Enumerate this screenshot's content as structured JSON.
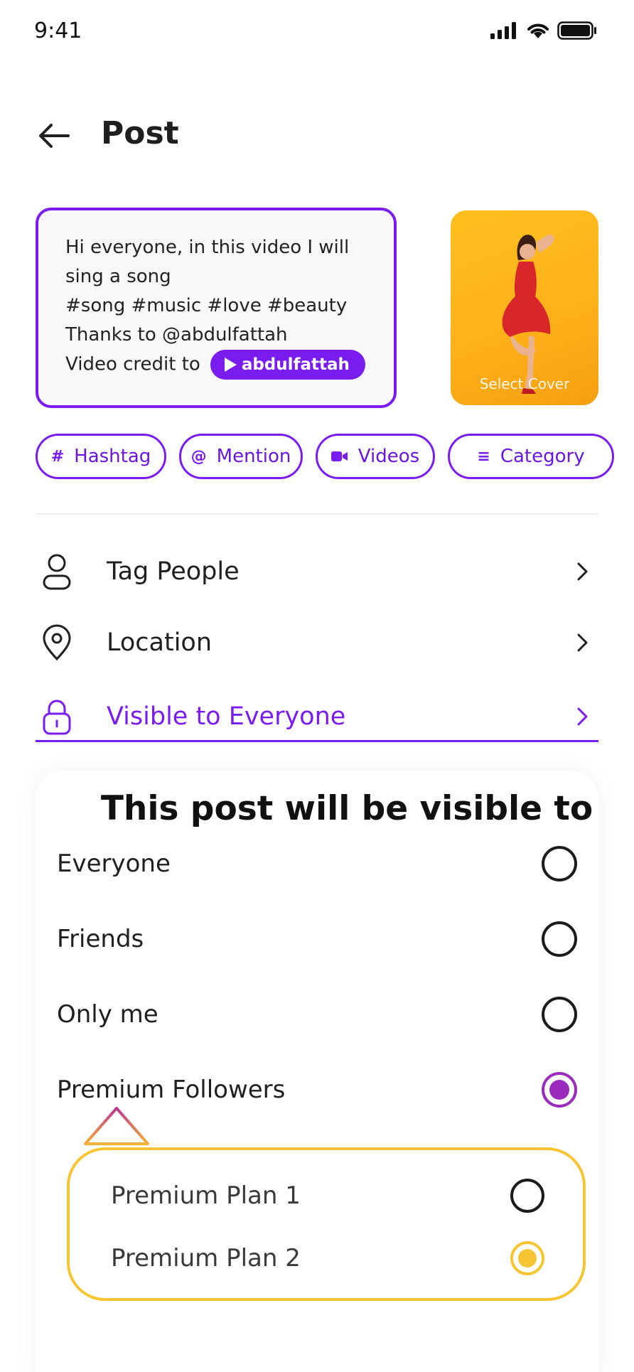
{
  "status_bar": {
    "time": "9:41"
  },
  "header": {
    "title": "Post"
  },
  "caption": {
    "lines": [
      "Hi everyone, in this video I will",
      "sing a song",
      "#song #music #love #beauty",
      "Thanks to @abdulfattah"
    ],
    "credit_prefix": "Video credit to",
    "credit_chip": "abdulfattah"
  },
  "cover": {
    "label": "Select Cover"
  },
  "chips": [
    {
      "label": "Hashtag",
      "glyph": "#"
    },
    {
      "label": "Mention",
      "glyph": "@"
    },
    {
      "label": "Videos",
      "icon": "video-icon"
    },
    {
      "label": "Category",
      "glyph": "≡"
    }
  ],
  "menu": {
    "tag_people": "Tag People",
    "location": "Location",
    "visibility": "Visible to Everyone"
  },
  "visibility_sheet": {
    "title": "This post will be visible to",
    "options": [
      {
        "label": "Everyone",
        "selected": false
      },
      {
        "label": "Friends",
        "selected": false
      },
      {
        "label": "Only me",
        "selected": false
      },
      {
        "label": "Premium Followers",
        "selected": true
      }
    ],
    "plans": [
      {
        "label": "Premium Plan 1",
        "selected": false
      },
      {
        "label": "Premium Plan 2",
        "selected": true
      }
    ]
  },
  "colors": {
    "accent": "#7a1cf0",
    "selected_purple": "#9b2bbd",
    "gold": "#f6c531",
    "cover_bg": "#ffb21a"
  }
}
